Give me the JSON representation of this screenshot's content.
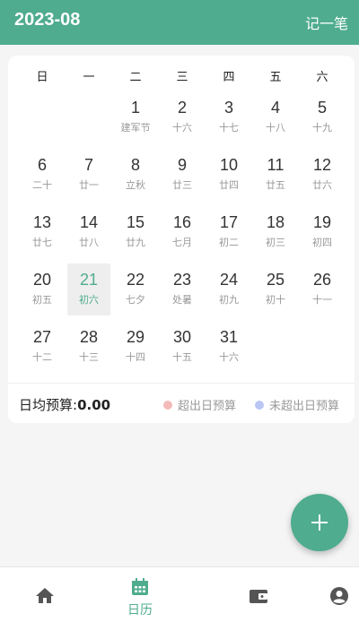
{
  "header": {
    "title": "2023-08",
    "action": "记一笔"
  },
  "weekdays": [
    "日",
    "一",
    "二",
    "三",
    "四",
    "五",
    "六"
  ],
  "days": [
    {
      "num": "1",
      "lunar": "建军节"
    },
    {
      "num": "2",
      "lunar": "十六"
    },
    {
      "num": "3",
      "lunar": "十七"
    },
    {
      "num": "4",
      "lunar": "十八"
    },
    {
      "num": "5",
      "lunar": "十九"
    },
    {
      "num": "6",
      "lunar": "二十"
    },
    {
      "num": "7",
      "lunar": "廿一"
    },
    {
      "num": "8",
      "lunar": "立秋"
    },
    {
      "num": "9",
      "lunar": "廿三"
    },
    {
      "num": "10",
      "lunar": "廿四"
    },
    {
      "num": "11",
      "lunar": "廿五"
    },
    {
      "num": "12",
      "lunar": "廿六"
    },
    {
      "num": "13",
      "lunar": "廿七"
    },
    {
      "num": "14",
      "lunar": "廿八"
    },
    {
      "num": "15",
      "lunar": "廿九"
    },
    {
      "num": "16",
      "lunar": "七月"
    },
    {
      "num": "17",
      "lunar": "初二"
    },
    {
      "num": "18",
      "lunar": "初三"
    },
    {
      "num": "19",
      "lunar": "初四"
    },
    {
      "num": "20",
      "lunar": "初五"
    },
    {
      "num": "21",
      "lunar": "初六"
    },
    {
      "num": "22",
      "lunar": "七夕"
    },
    {
      "num": "23",
      "lunar": "处暑"
    },
    {
      "num": "24",
      "lunar": "初九"
    },
    {
      "num": "25",
      "lunar": "初十"
    },
    {
      "num": "26",
      "lunar": "十一"
    },
    {
      "num": "27",
      "lunar": "十二"
    },
    {
      "num": "28",
      "lunar": "十三"
    },
    {
      "num": "29",
      "lunar": "十四"
    },
    {
      "num": "30",
      "lunar": "十五"
    },
    {
      "num": "31",
      "lunar": "十六"
    }
  ],
  "selected_day": "21",
  "budget": {
    "label": "日均预算:",
    "value": "0.00"
  },
  "legend": {
    "over": {
      "label": "超出日预算",
      "color": "#f4b9b9"
    },
    "under": {
      "label": "未超出日预算",
      "color": "#b9c6f4"
    }
  },
  "fab": {
    "icon": "plus-icon"
  },
  "tabbar": {
    "active_label": "日历",
    "icons": [
      "home-icon",
      "calendar-icon",
      "wallet-icon",
      "account-icon"
    ]
  },
  "colors": {
    "accent": "#4fac8e"
  }
}
